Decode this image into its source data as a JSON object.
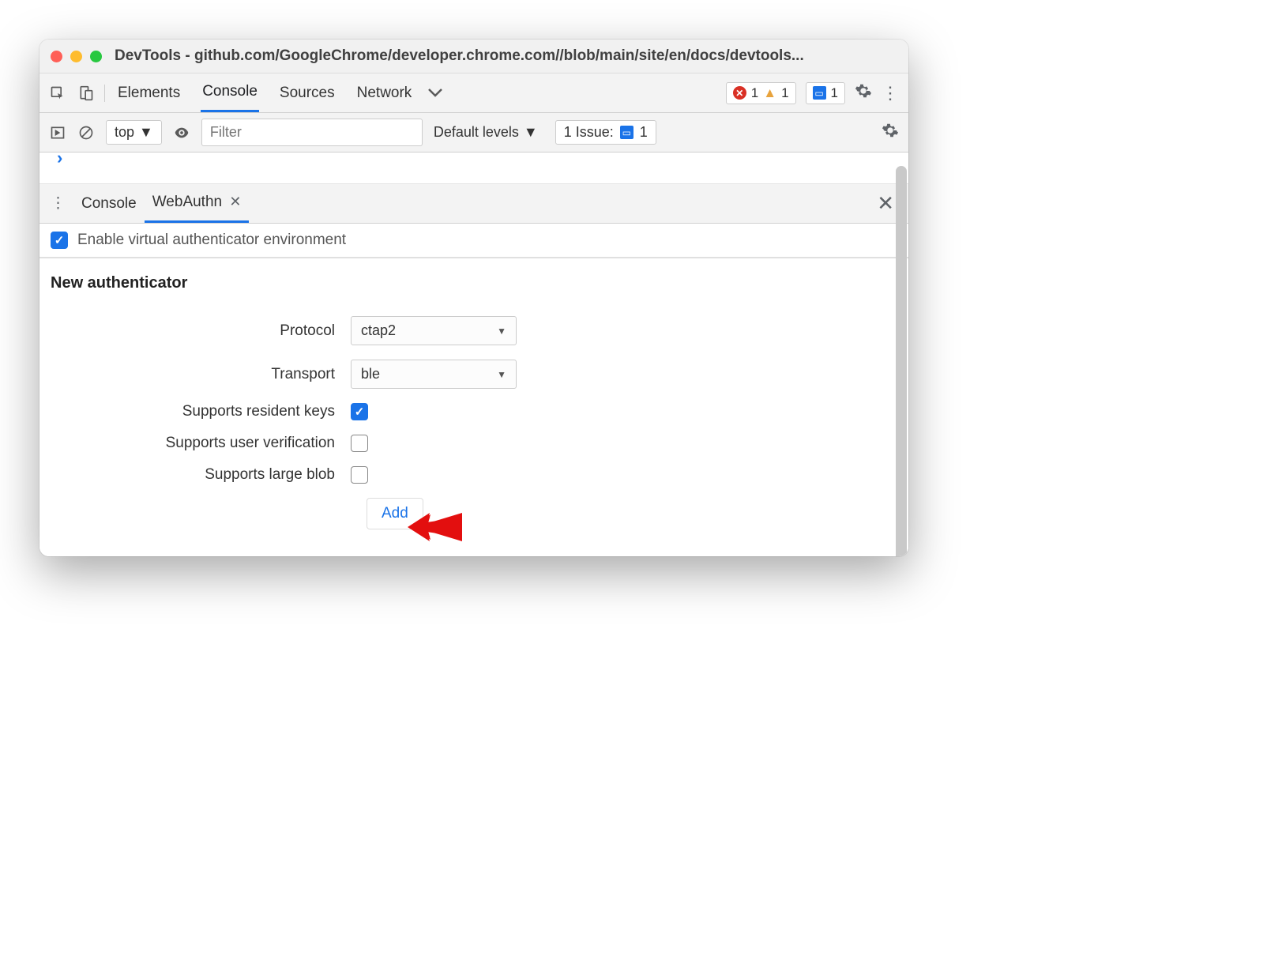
{
  "window": {
    "title": "DevTools - github.com/GoogleChrome/developer.chrome.com//blob/main/site/en/docs/devtools..."
  },
  "main_tabs": {
    "items": [
      "Elements",
      "Console",
      "Sources",
      "Network"
    ],
    "active": "Console"
  },
  "status": {
    "errors": "1",
    "warnings": "1",
    "messages": "1"
  },
  "console_toolbar": {
    "context": "top",
    "filter_placeholder": "Filter",
    "levels": "Default levels",
    "issues_label": "1 Issue:",
    "issues_count": "1"
  },
  "drawer": {
    "tabs": [
      "Console",
      "WebAuthn"
    ],
    "active": "WebAuthn"
  },
  "webauthn": {
    "enable_label": "Enable virtual authenticator environment",
    "enable_checked": true,
    "section_title": "New authenticator",
    "protocol_label": "Protocol",
    "protocol_value": "ctap2",
    "transport_label": "Transport",
    "transport_value": "ble",
    "resident_label": "Supports resident keys",
    "resident_checked": true,
    "userverif_label": "Supports user verification",
    "userverif_checked": false,
    "largeblob_label": "Supports large blob",
    "largeblob_checked": false,
    "add_label": "Add"
  }
}
